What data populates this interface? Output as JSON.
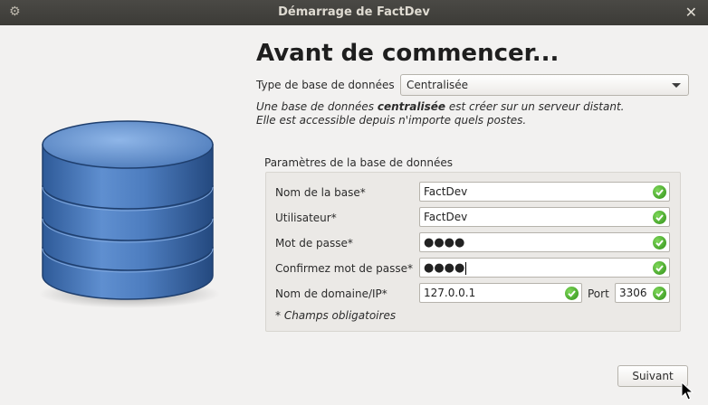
{
  "window": {
    "title": "Démarrage de FactDev"
  },
  "heading": "Avant de commencer...",
  "db_type": {
    "label": "Type de base de données",
    "selected": "Centralisée"
  },
  "description": {
    "line1_pre": "Une base de données ",
    "line1_bold": "centralisée",
    "line1_post": " est créer sur un serveur distant.",
    "line2": "Elle est accessible depuis n'importe quels postes."
  },
  "params": {
    "group_title": "Paramètres de la base de données",
    "db_name": {
      "label": "Nom de la base*",
      "value": "FactDev",
      "valid": true
    },
    "user": {
      "label": "Utilisateur*",
      "value": "FactDev",
      "valid": true
    },
    "password": {
      "label": "Mot de passe*",
      "value": "●●●●",
      "valid": true
    },
    "confirm_password": {
      "label": "Confirmez mot de passe*",
      "value": "●●●●",
      "valid": true
    },
    "host": {
      "label": "Nom de domaine/IP*",
      "value": "127.0.0.1",
      "valid": true
    },
    "port": {
      "label": "Port",
      "value": "3306",
      "valid": true
    },
    "required_note": "* Champs obligatoires"
  },
  "buttons": {
    "next": "Suivant"
  },
  "icons": {
    "valid": "check-circle-icon",
    "menu": "gear-icon",
    "close": "close-icon",
    "illustration": "database-icon"
  },
  "colors": {
    "valid_green": "#3a9a1f",
    "db_blue": "#4f7cbf",
    "titlebar": "#3c3b37"
  }
}
